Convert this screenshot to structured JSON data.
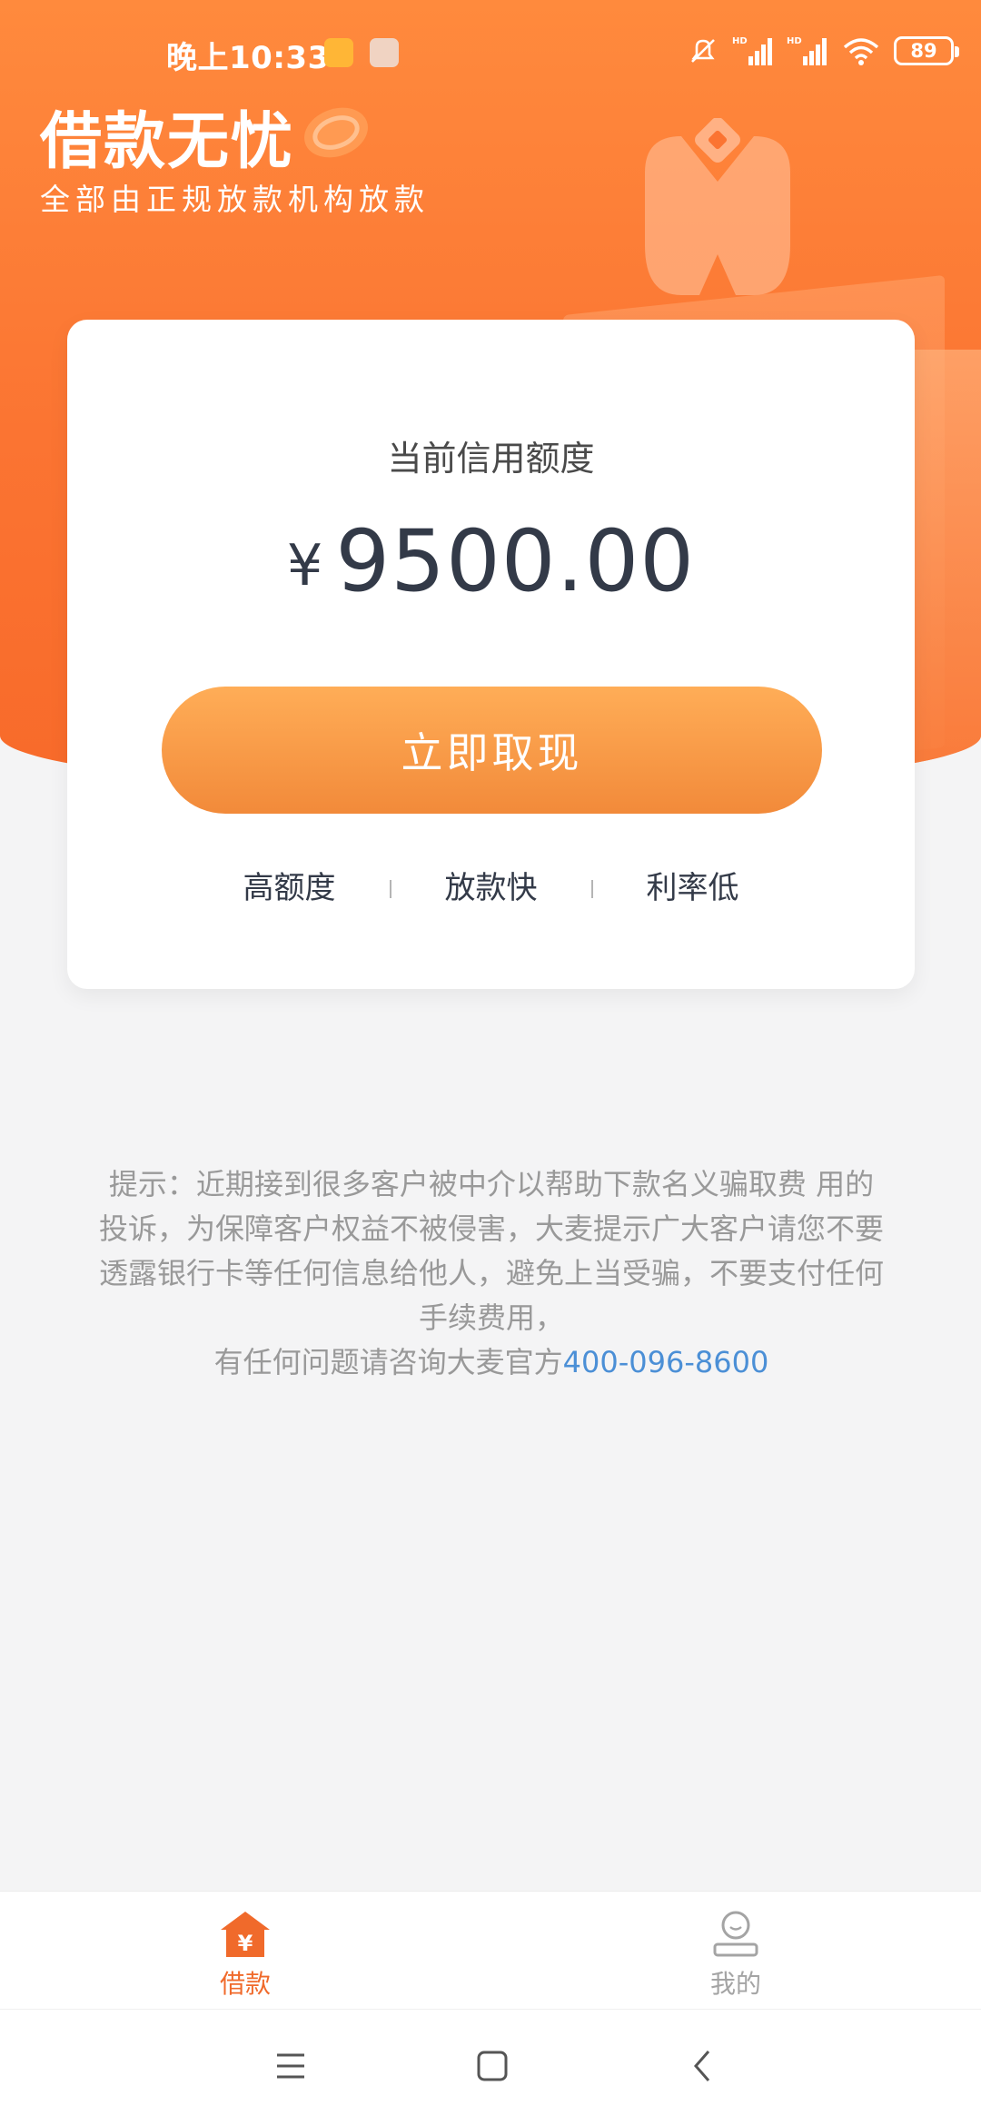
{
  "status_bar": {
    "time": "晚上10:33",
    "battery": "89",
    "network_labels": [
      "HD",
      "HD"
    ]
  },
  "brand": {
    "title": "借款无忧",
    "subtitle": "全部由正规放款机构放款"
  },
  "card": {
    "label": "当前信用额度",
    "currency": "¥",
    "amount": "9500.00",
    "button": "立即取现",
    "features": [
      "高额度",
      "放款快",
      "利率低"
    ]
  },
  "notice": {
    "text": "提示：近期接到很多客户被中介以帮助下款名义骗取费 用的投诉，为保障客户权益不被侵害，大麦提示广大客户请您不要透露银行卡等任何信息给他人，避免上当受骗，不要支付任何手续费用，",
    "contact_prefix": "有任何问题请咨询大麦官方",
    "phone": "400-096-8600"
  },
  "tabbar": {
    "items": [
      {
        "label": "借款",
        "icon": "loan-house-icon",
        "active": true
      },
      {
        "label": "我的",
        "icon": "profile-icon",
        "active": false
      }
    ]
  },
  "colors": {
    "brand_orange": "#fb7432",
    "button_orange": "#f6963f",
    "link_blue": "#4b8fd6",
    "active_tab": "#f06a2b"
  }
}
